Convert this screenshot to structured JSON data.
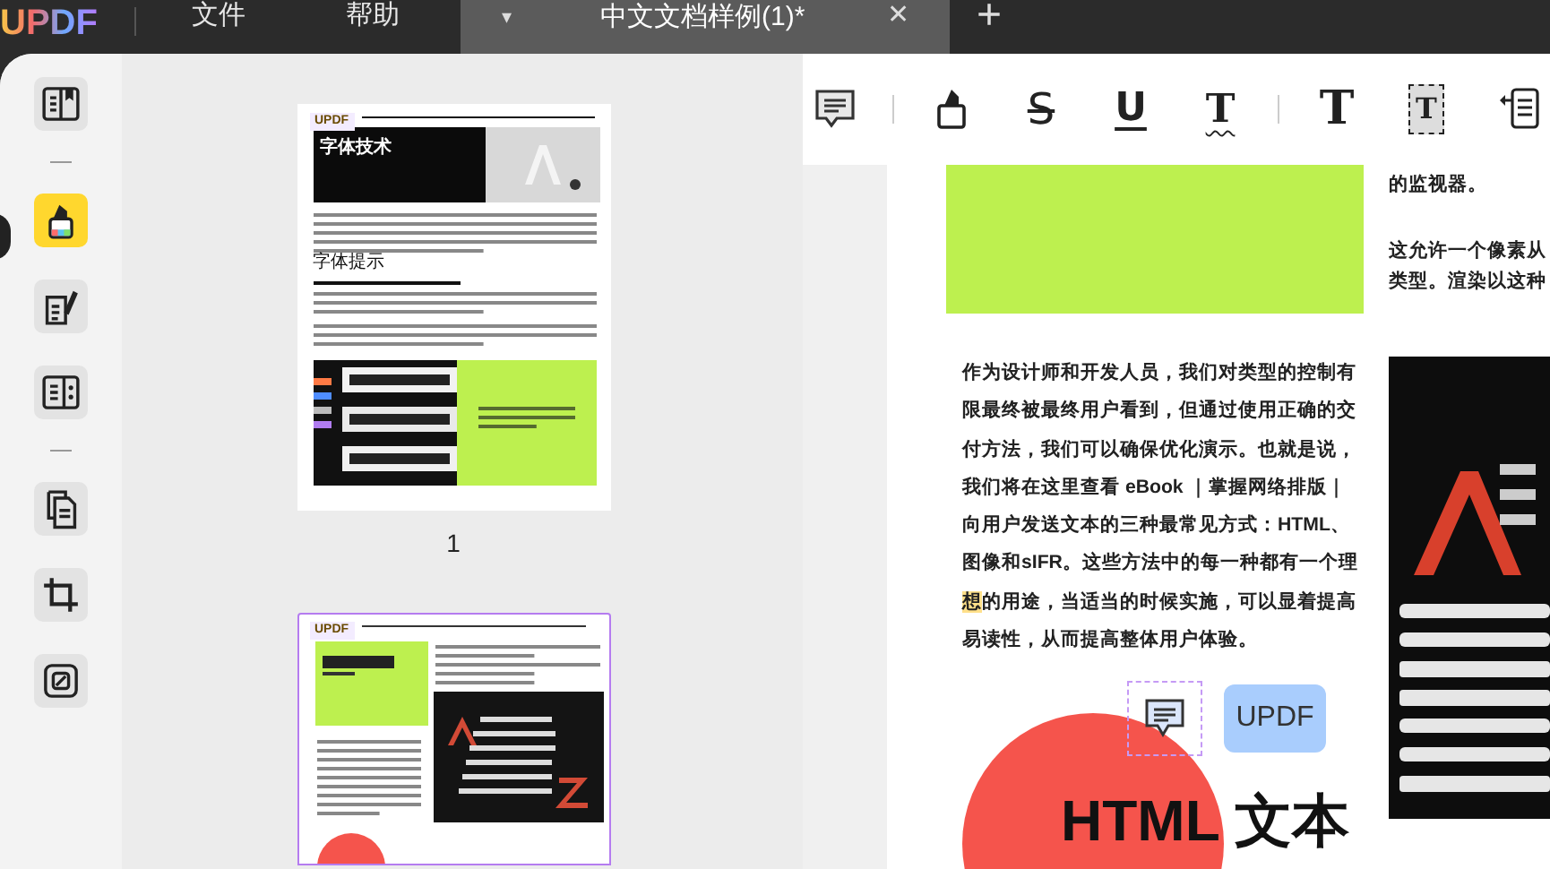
{
  "app": {
    "logo": "UPDF",
    "menu": [
      "文件",
      "帮助"
    ]
  },
  "tab": {
    "title": "中文文档样例(1)*",
    "dropdown": "▾",
    "close": "✕",
    "new": "+",
    "selected": true
  },
  "sidebar": {
    "groups": [
      [
        {
          "kind": "reader",
          "selected": false
        }
      ],
      [
        {
          "kind": "highlighter",
          "selected": true
        },
        {
          "kind": "edit",
          "selected": false
        },
        {
          "kind": "form",
          "selected": false
        }
      ],
      [
        {
          "kind": "pages",
          "selected": false
        },
        {
          "kind": "crop",
          "selected": false
        },
        {
          "kind": "layers",
          "selected": false
        }
      ]
    ]
  },
  "thumbnails": [
    {
      "label": "1",
      "selected": false,
      "kind": "page1",
      "logo": "UPDF",
      "heading": "字体技术",
      "subheading": "字体提示"
    },
    {
      "kind": "page2",
      "selected": true,
      "logo": "UPDF"
    }
  ],
  "toolbar": {
    "groups": [
      [
        {
          "kind": "comment"
        }
      ],
      [
        {
          "kind": "highlight"
        },
        {
          "kind": "strikethrough",
          "glyph": "S"
        },
        {
          "kind": "underline",
          "glyph": "U"
        },
        {
          "kind": "squiggly",
          "glyph": "T"
        }
      ],
      [
        {
          "kind": "text",
          "glyph": "T"
        },
        {
          "kind": "textbox",
          "glyph": "T"
        },
        {
          "kind": "callout"
        }
      ]
    ]
  },
  "document": {
    "paragraph": [
      [
        {
          "text": "作为设计师和开发人员，我们对类型的控制有"
        }
      ],
      [
        {
          "text": "限最终被最终用户看到，但通过使用正确的交"
        }
      ],
      [
        {
          "text": "付方法，我们可以确保优化演示。也就是说，"
        }
      ],
      [
        {
          "text": "我们将在这里查看 eBook ｜掌握网络排版｜"
        }
      ],
      [
        {
          "text": "向用户发送文本的三种最常见方式：HTML、"
        }
      ],
      [
        {
          "text": "图像和sIFR。这些方法中的每一种都有一个理"
        }
      ],
      [
        {
          "text": "想",
          "highlighted": true
        },
        {
          "text": "的用途，当适当的时候实施，可以显着提高"
        }
      ],
      [
        {
          "text": "易读性，从而提高整体用户体验。"
        }
      ]
    ],
    "badge": "UPDF",
    "heading": "HTML 文本",
    "side_text": [
      "的监视器。",
      "这允许一个像素从",
      "类型。渲染以这种"
    ]
  }
}
